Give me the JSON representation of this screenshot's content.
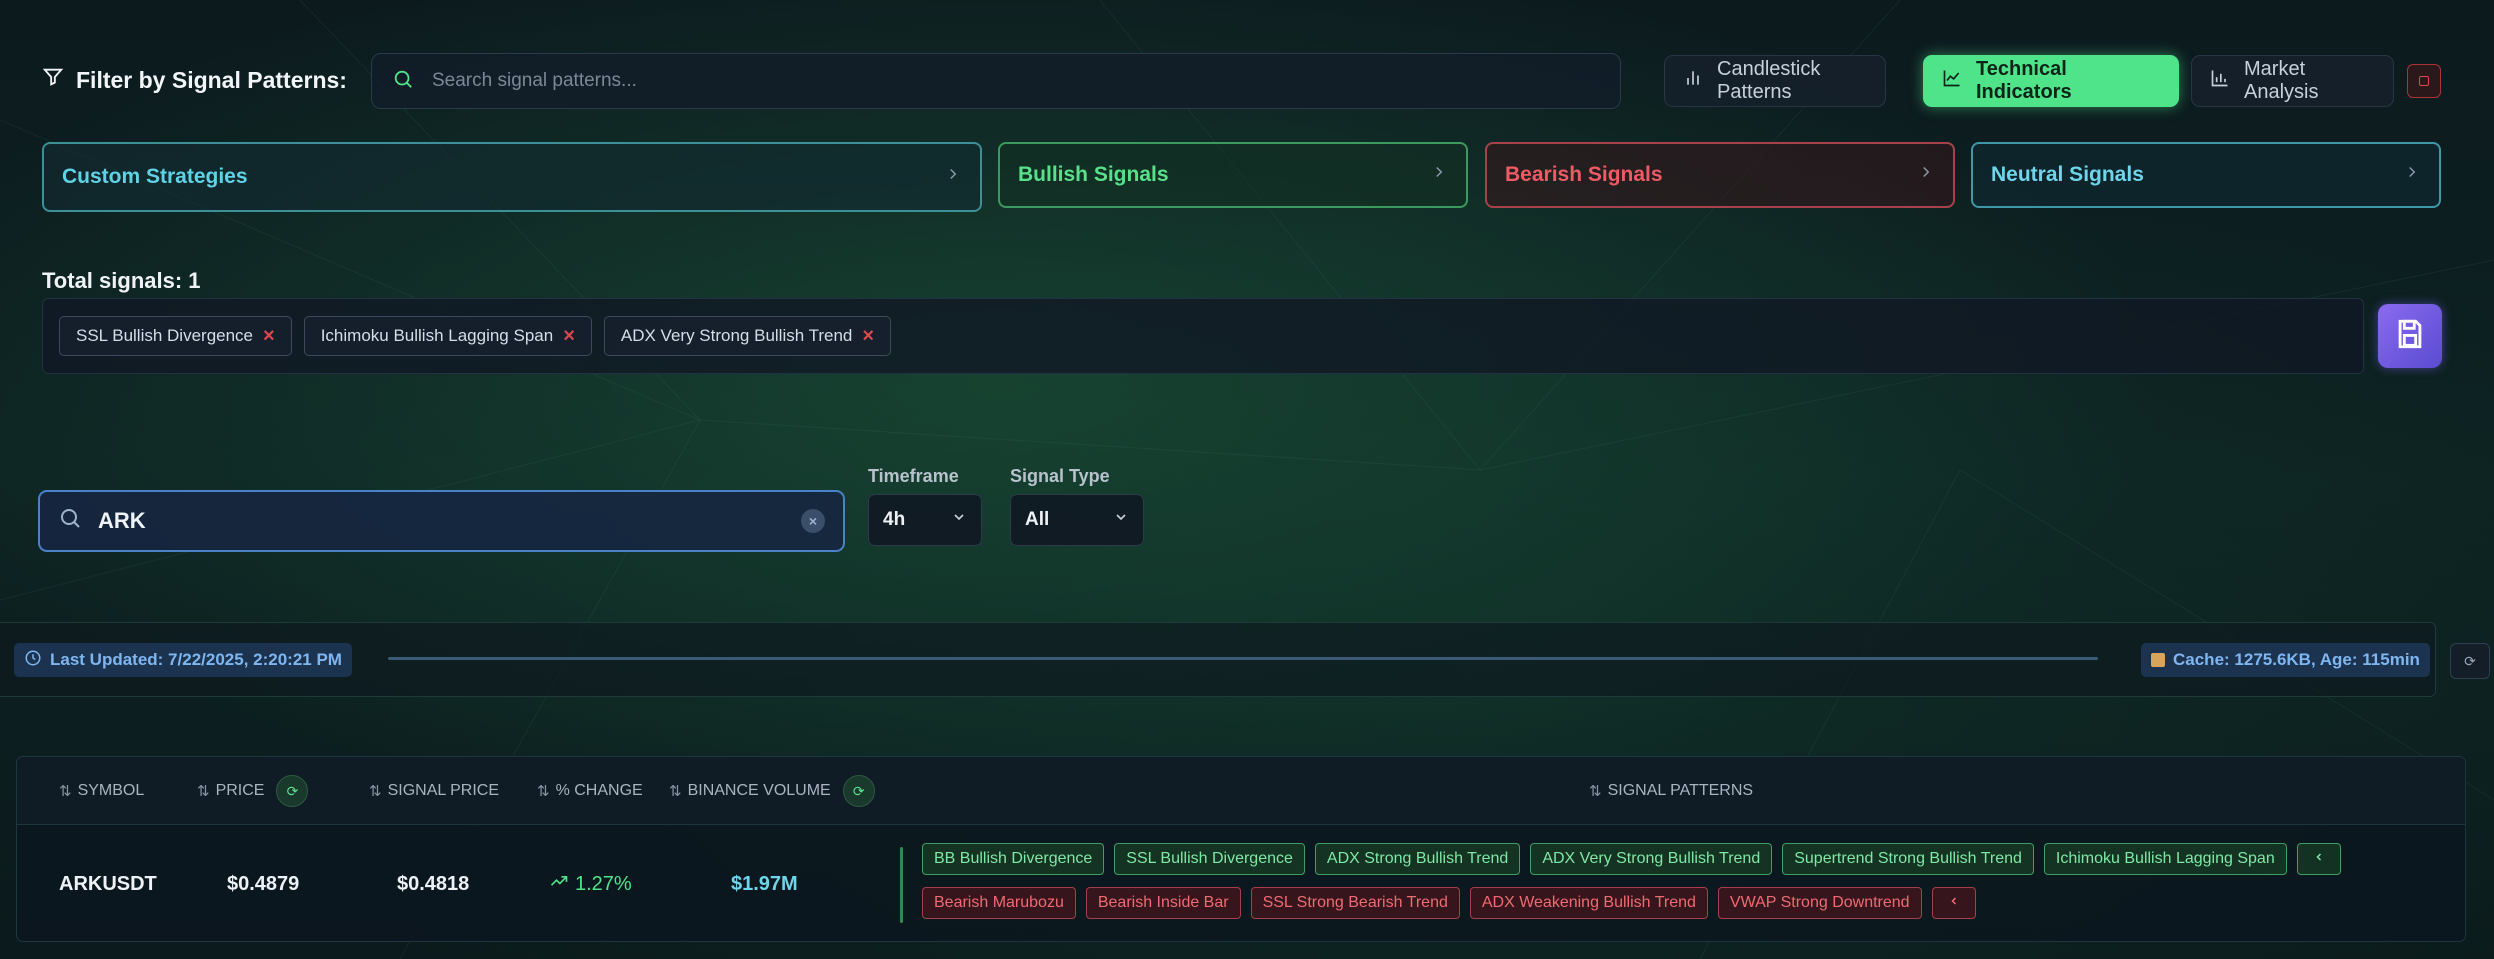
{
  "filter": {
    "title": "Filter by Signal Patterns:",
    "search_placeholder": "Search signal patterns...",
    "tabs": [
      {
        "label": "Candlestick Patterns",
        "active": false
      },
      {
        "label": "Technical Indicators",
        "active": true
      },
      {
        "label": "Market Analysis",
        "active": false
      }
    ]
  },
  "categories": {
    "custom": "Custom Strategies",
    "bullish": "Bullish Signals",
    "bearish": "Bearish Signals",
    "neutral": "Neutral Signals"
  },
  "selection": {
    "total_label": "Total signals: 1",
    "chips": [
      "SSL Bullish Divergence",
      "Ichimoku Bullish Lagging Span",
      "ADX Very Strong Bullish Trend"
    ]
  },
  "symbol_search": {
    "value": "ARK",
    "clear_symbol": "×"
  },
  "timeframe": {
    "label": "Timeframe",
    "value": "4h"
  },
  "signal_type": {
    "label": "Signal Type",
    "value": "All"
  },
  "status": {
    "last_updated": "Last Updated: 7/22/2025, 2:20:21 PM",
    "cache": "Cache: 1275.6KB, Age: 115min"
  },
  "table": {
    "headers": {
      "symbol": "SYMBOL",
      "price": "PRICE",
      "signal_price": "SIGNAL PRICE",
      "change": "% CHANGE",
      "volume": "BINANCE VOLUME",
      "patterns": "SIGNAL PATTERNS"
    },
    "rows": [
      {
        "symbol": "ARKUSDT",
        "price": "$0.4879",
        "signal_price": "$0.4818",
        "change": "1.27%",
        "volume": "$1.97M",
        "bullish_patterns": [
          "BB Bullish Divergence",
          "SSL Bullish Divergence",
          "ADX Strong Bullish Trend",
          "ADX Very Strong Bullish Trend",
          "Supertrend Strong Bullish Trend",
          "Ichimoku Bullish Lagging Span"
        ],
        "bearish_patterns": [
          "Bearish Marubozu",
          "Bearish Inside Bar",
          "SSL Strong Bearish Trend",
          "ADX Weakening Bullish Trend",
          "VWAP Strong Downtrend"
        ]
      }
    ]
  },
  "colors": {
    "accent_green": "#4fe38a",
    "bearish_red": "#ef5a64",
    "neutral_cyan": "#6fd5ea",
    "save_purple": "#7a5ce6"
  }
}
